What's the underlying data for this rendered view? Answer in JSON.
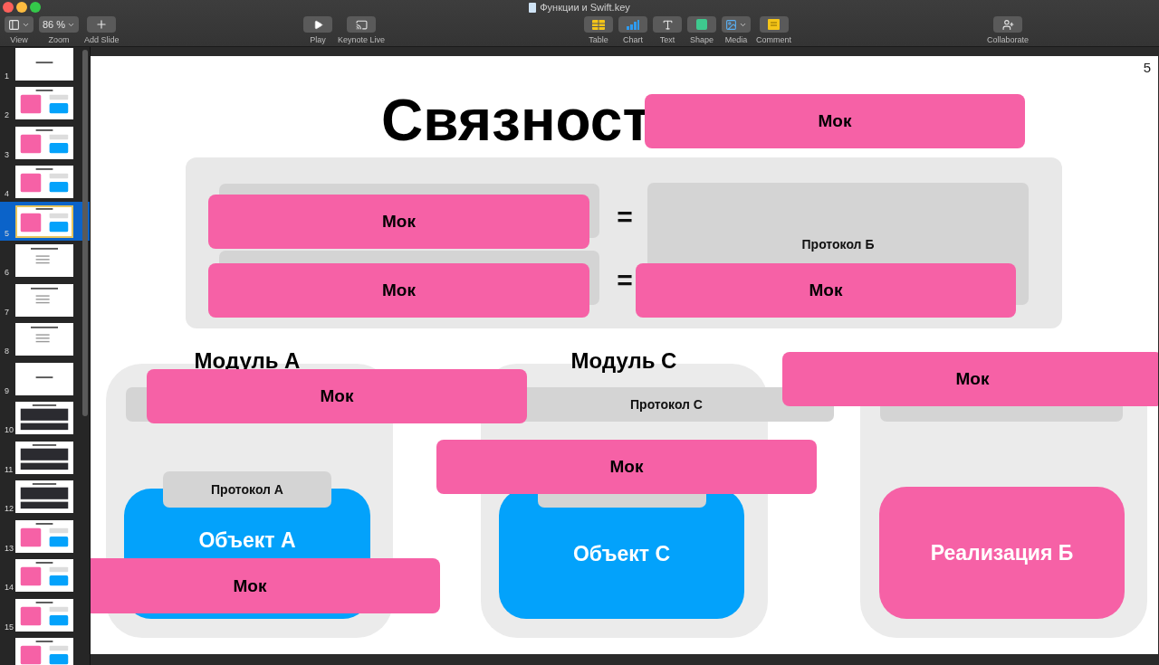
{
  "window": {
    "title": "Функции и Swift.key"
  },
  "toolbar": {
    "groups": [
      [
        {
          "kind": "view",
          "label": "View"
        },
        {
          "kind": "zoom",
          "label": "Zoom",
          "value": "86 %"
        },
        {
          "kind": "add",
          "label": "Add Slide"
        }
      ],
      [
        {
          "kind": "play",
          "label": "Play"
        },
        {
          "kind": "live",
          "label": "Keynote Live"
        }
      ],
      [
        {
          "kind": "table",
          "label": "Table"
        },
        {
          "kind": "chart",
          "label": "Chart"
        },
        {
          "kind": "text",
          "label": "Text"
        },
        {
          "kind": "shape",
          "label": "Shape"
        },
        {
          "kind": "media",
          "label": "Media"
        },
        {
          "kind": "comment",
          "label": "Comment"
        }
      ],
      [
        {
          "kind": "collaborate",
          "label": "Collaborate"
        }
      ]
    ]
  },
  "sidebar": {
    "items": [
      {
        "number": "1",
        "kind": "title",
        "selected": false
      },
      {
        "number": "2",
        "kind": "diagram",
        "selected": false
      },
      {
        "number": "3",
        "kind": "diagram",
        "selected": false
      },
      {
        "number": "4",
        "kind": "diagram",
        "selected": false
      },
      {
        "number": "5",
        "kind": "diagram",
        "selected": true
      },
      {
        "number": "6",
        "kind": "list",
        "selected": false
      },
      {
        "number": "7",
        "kind": "list",
        "selected": false
      },
      {
        "number": "8",
        "kind": "list",
        "selected": false
      },
      {
        "number": "9",
        "kind": "title",
        "selected": false
      },
      {
        "number": "10",
        "kind": "code",
        "selected": false
      },
      {
        "number": "11",
        "kind": "code",
        "selected": false
      },
      {
        "number": "12",
        "kind": "code",
        "selected": false
      },
      {
        "number": "13",
        "kind": "diagram",
        "selected": false
      },
      {
        "number": "14",
        "kind": "diagram",
        "selected": false
      },
      {
        "number": "15",
        "kind": "diagram",
        "selected": false
      },
      {
        "kind": "diagram",
        "selected": false
      }
    ]
  },
  "slide": {
    "page_number": "5",
    "elements": [
      {
        "kind": "title",
        "text": "Связност"
      },
      {
        "kind": "panel"
      },
      {
        "kind": "gray"
      },
      {
        "kind": "gray"
      },
      {
        "kind": "gray",
        "text": "Протокол Б"
      },
      {
        "kind": "equals",
        "text": "="
      },
      {
        "kind": "equals",
        "text": "="
      },
      {
        "kind": "module"
      },
      {
        "kind": "module"
      },
      {
        "kind": "module"
      },
      {
        "kind": "heading",
        "text": "Модуль А"
      },
      {
        "kind": "heading",
        "text": "Модуль С"
      },
      {
        "kind": "gray"
      },
      {
        "kind": "gray",
        "text": "Протокол С"
      },
      {
        "kind": "gray"
      },
      {
        "kind": "object",
        "text": "Объект А"
      },
      {
        "kind": "object",
        "text": "Объект С"
      },
      {
        "kind": "gray",
        "text": "Протокол А"
      },
      {
        "kind": "gray"
      },
      {
        "kind": "implementation",
        "text": "Реализация Б"
      },
      {
        "kind": "mock",
        "text": "Мок"
      },
      {
        "kind": "mock",
        "text": "Мок"
      },
      {
        "kind": "mock",
        "text": "Мок"
      },
      {
        "kind": "mock",
        "text": "Мок"
      },
      {
        "kind": "mock",
        "text": "Мок"
      },
      {
        "kind": "mock",
        "text": "Мок"
      },
      {
        "kind": "mock",
        "text": "Мок"
      },
      {
        "kind": "mock",
        "text": "Мок"
      }
    ]
  }
}
